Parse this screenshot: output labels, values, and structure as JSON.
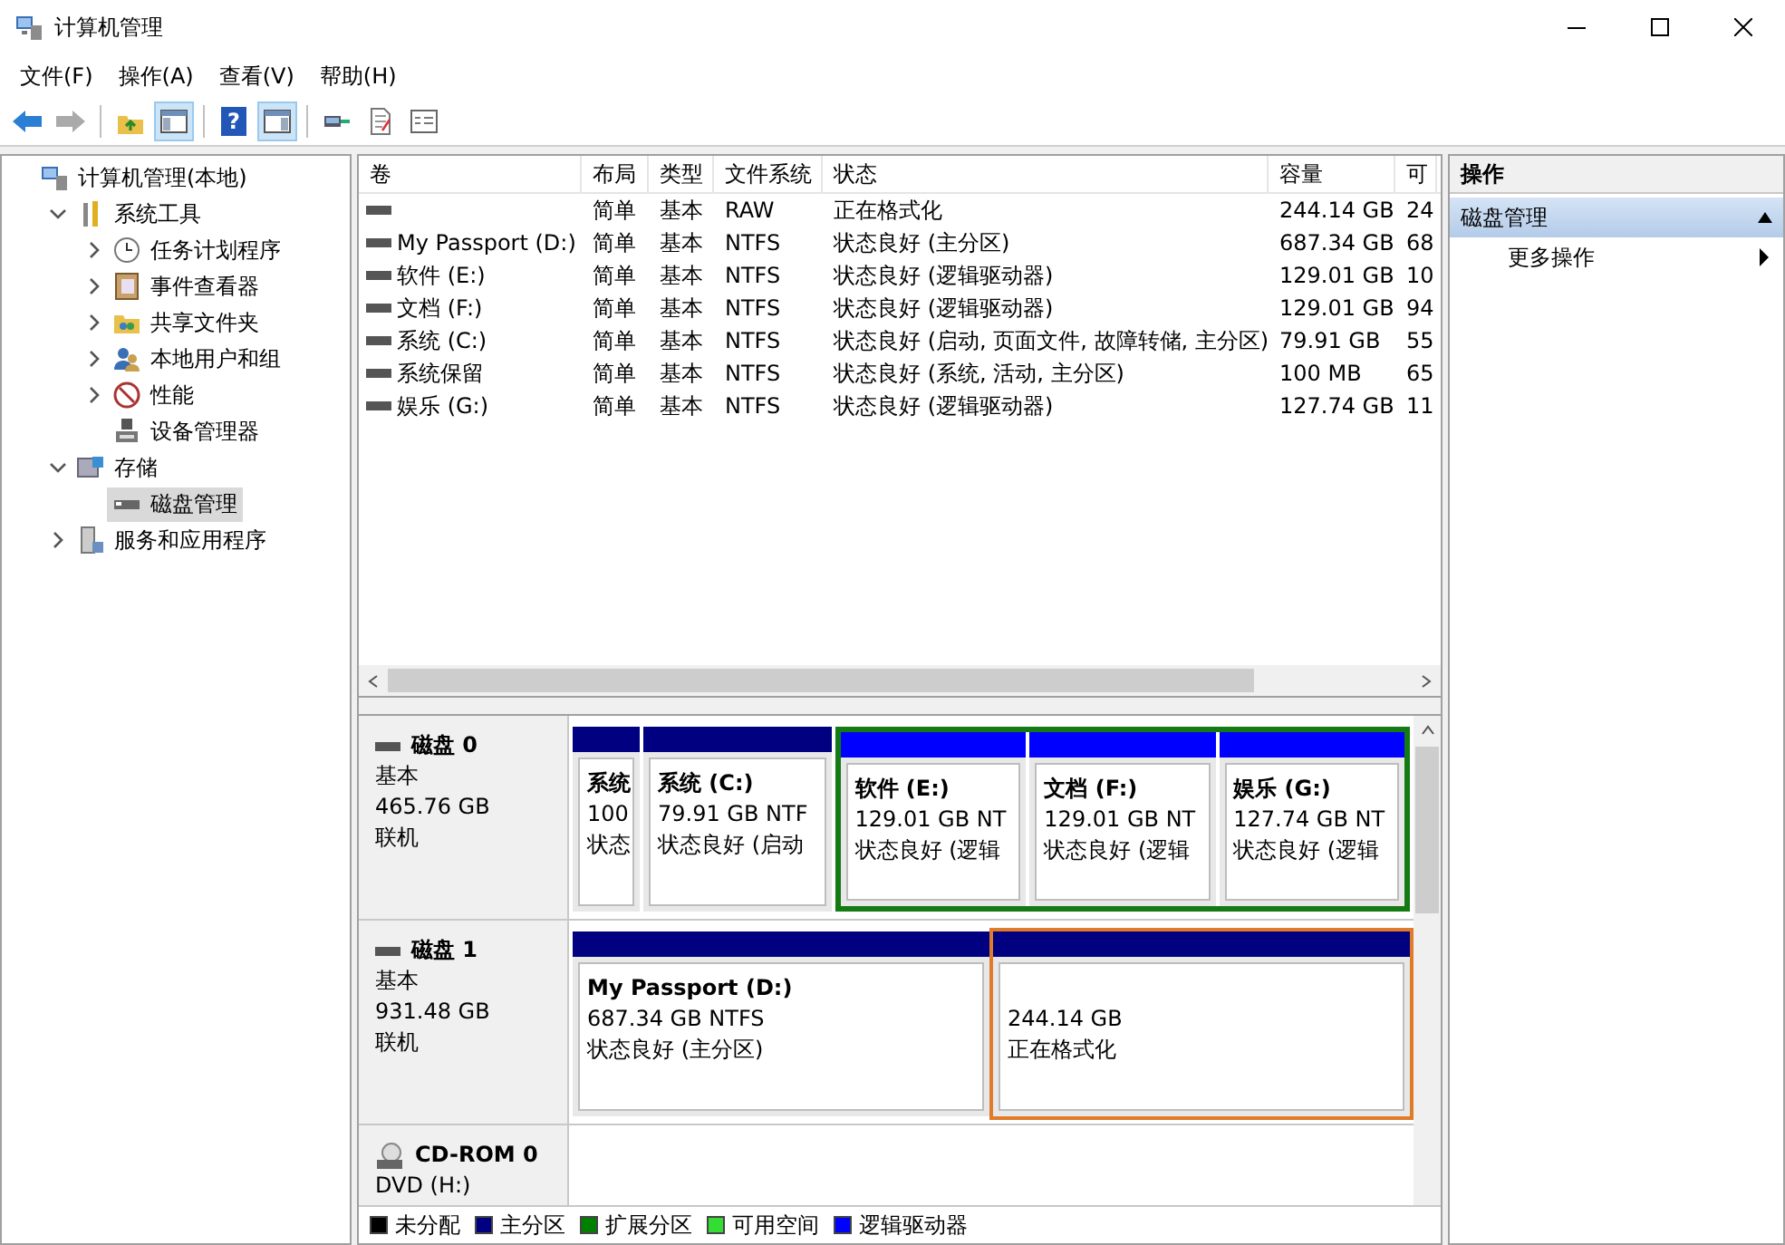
{
  "window": {
    "title": "计算机管理"
  },
  "menu": [
    {
      "label": "文件(F)"
    },
    {
      "label": "操作(A)"
    },
    {
      "label": "查看(V)"
    },
    {
      "label": "帮助(H)"
    }
  ],
  "toolbar": [
    {
      "disabled": false,
      "pressed": false
    },
    {
      "disabled": true,
      "pressed": false
    },
    {
      "disabled": false,
      "pressed": false
    },
    {
      "disabled": false,
      "pressed": true
    },
    {
      "disabled": false,
      "pressed": false,
      "glyph": "?"
    },
    {
      "disabled": false,
      "pressed": true
    },
    {
      "disabled": false,
      "pressed": false
    },
    {
      "disabled": false,
      "pressed": false
    },
    {
      "disabled": false,
      "pressed": false
    }
  ],
  "tree": [
    {
      "label": "计算机管理(本地)",
      "selected": false,
      "children": [
        {
          "label": "系统工具",
          "expanded": true,
          "selected": false,
          "children": [
            {
              "label": "任务计划程序",
              "expanded": false,
              "selected": false
            },
            {
              "label": "事件查看器",
              "expanded": false,
              "selected": false
            },
            {
              "label": "共享文件夹",
              "expanded": false,
              "selected": false
            },
            {
              "label": "本地用户和组",
              "expanded": false,
              "selected": false
            },
            {
              "label": "性能",
              "expanded": false,
              "selected": false
            },
            {
              "label": "设备管理器",
              "selected": false
            }
          ]
        },
        {
          "label": "存储",
          "expanded": true,
          "selected": false,
          "children": [
            {
              "label": "磁盘管理",
              "selected": true
            }
          ]
        },
        {
          "label": "服务和应用程序",
          "expanded": false,
          "selected": false
        }
      ]
    }
  ],
  "volume_table": {
    "columns": [
      "卷",
      "布局",
      "类型",
      "文件系统",
      "状态",
      "容量",
      "可"
    ],
    "rows": [
      [
        "",
        "简单",
        "基本",
        "RAW",
        "正在格式化",
        "244.14 GB",
        "24"
      ],
      [
        "My Passport (D:)",
        "简单",
        "基本",
        "NTFS",
        "状态良好 (主分区)",
        "687.34 GB",
        "68"
      ],
      [
        "软件 (E:)",
        "简单",
        "基本",
        "NTFS",
        "状态良好 (逻辑驱动器)",
        "129.01 GB",
        "10"
      ],
      [
        "文档 (F:)",
        "简单",
        "基本",
        "NTFS",
        "状态良好 (逻辑驱动器)",
        "129.01 GB",
        "94"
      ],
      [
        "系统 (C:)",
        "简单",
        "基本",
        "NTFS",
        "状态良好 (启动, 页面文件, 故障转储, 主分区)",
        "79.91 GB",
        "55"
      ],
      [
        "系统保留",
        "简单",
        "基本",
        "NTFS",
        "状态良好 (系统, 活动, 主分区)",
        "100 MB",
        "65"
      ],
      [
        "娱乐 (G:)",
        "简单",
        "基本",
        "NTFS",
        "状态良好 (逻辑驱动器)",
        "127.74 GB",
        "11"
      ]
    ]
  },
  "disks": [
    {
      "kind": "disk",
      "name": "磁盘 0",
      "type": "基本",
      "size": "465.76 GB",
      "status": "联机",
      "partitions": [
        {
          "kind": "primary",
          "name": "系统",
          "size": "100",
          "status": "状态",
          "highlighted": false
        },
        {
          "kind": "primary",
          "name": "系统 (C:)",
          "size": "79.91 GB NTF",
          "status": "状态良好 (启动",
          "highlighted": false
        },
        {
          "kind": "extended",
          "partitions": [
            {
              "kind": "logical",
              "name": "软件 (E:)",
              "size": "129.01 GB NT",
              "status": "状态良好 (逻辑",
              "highlighted": false
            },
            {
              "kind": "logical",
              "name": "文档 (F:)",
              "size": "129.01 GB NT",
              "status": "状态良好 (逻辑",
              "highlighted": false
            },
            {
              "kind": "logical",
              "name": "娱乐 (G:)",
              "size": "127.74 GB NT",
              "status": "状态良好 (逻辑",
              "highlighted": false
            }
          ]
        }
      ]
    },
    {
      "kind": "disk",
      "name": "磁盘 1",
      "type": "基本",
      "size": "931.48 GB",
      "status": "联机",
      "partitions": [
        {
          "kind": "primary",
          "name": "My Passport (D:)",
          "size": "687.34 GB NTFS",
          "status": "状态良好 (主分区)",
          "highlighted": false
        },
        {
          "kind": "primary",
          "size": "244.14 GB",
          "status": "正在格式化",
          "highlighted": true
        }
      ]
    },
    {
      "kind": "cdrom",
      "name": "CD-ROM 0",
      "drive": "DVD (H:)"
    }
  ],
  "legend": [
    {
      "label": "未分配",
      "color": "#000000"
    },
    {
      "label": "主分区",
      "color": "#000080"
    },
    {
      "label": "扩展分区",
      "color": "#008000"
    },
    {
      "label": "可用空间",
      "color": "#33dd33"
    },
    {
      "label": "逻辑驱动器",
      "color": "#0000ff"
    }
  ],
  "actions": {
    "title": "操作",
    "sections": [
      {
        "label": "磁盘管理",
        "expanded": true,
        "items": [
          {
            "label": "更多操作",
            "has_submenu": true
          }
        ]
      }
    ]
  }
}
